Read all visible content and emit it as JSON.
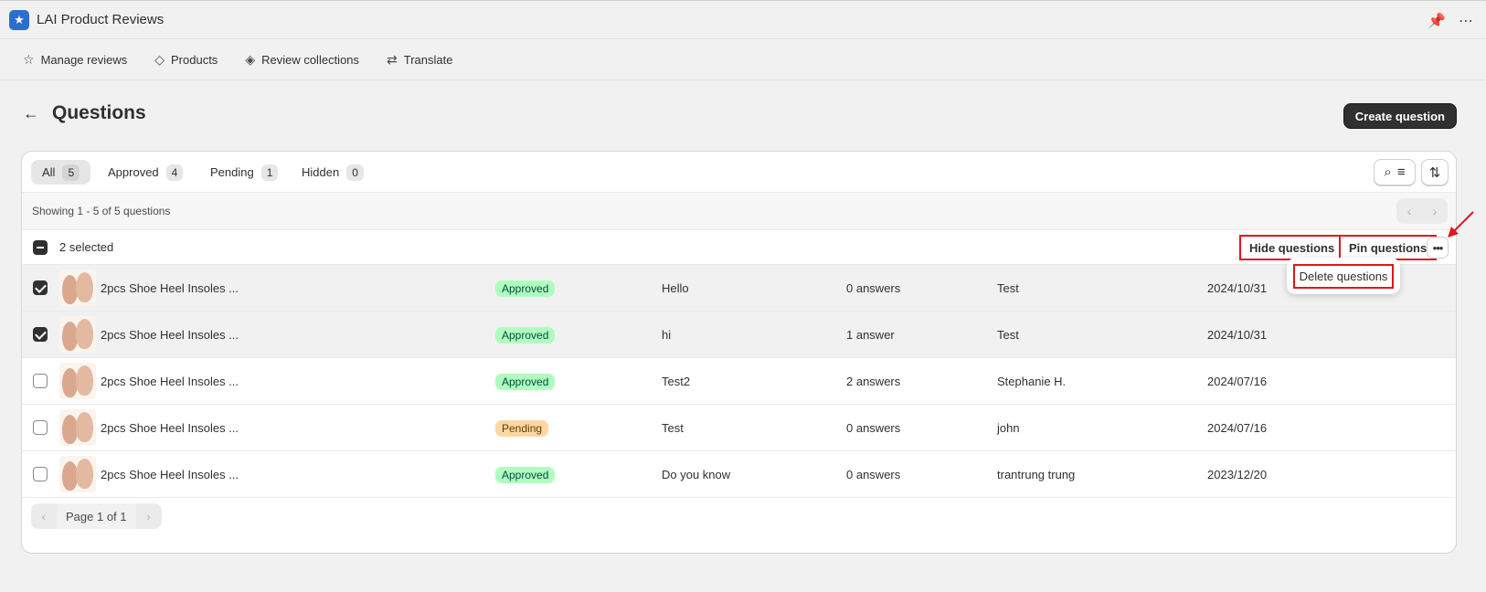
{
  "app": {
    "title": "LAI Product Reviews",
    "logo_icon": "star-app-icon"
  },
  "topbar": {
    "pin_icon": "pin-icon",
    "more_icon": "more-horizontal-icon"
  },
  "nav": [
    {
      "label": "Manage reviews",
      "icon": "☆"
    },
    {
      "label": "Products",
      "icon": "◇"
    },
    {
      "label": "Review collections",
      "icon": "◈"
    },
    {
      "label": "Translate",
      "icon": "⇄"
    }
  ],
  "page": {
    "title": "Questions",
    "create_button": "Create question"
  },
  "tabs": [
    {
      "label": "All",
      "count": "5"
    },
    {
      "label": "Approved",
      "count": "4"
    },
    {
      "label": "Pending",
      "count": "1"
    },
    {
      "label": "Hidden",
      "count": "0"
    }
  ],
  "showing": "Showing 1 - 5 of 5 questions",
  "bulk": {
    "selected": "2 selected",
    "hide": "Hide questions",
    "pin": "Pin questions",
    "more": "•••",
    "delete": "Delete questions"
  },
  "rows": [
    {
      "checked": true,
      "product": "2pcs Shoe Heel Insoles ...",
      "status": "Approved",
      "question": "Hello",
      "answers": "0 answers",
      "author": "Test",
      "date": "2024/10/31"
    },
    {
      "checked": true,
      "product": "2pcs Shoe Heel Insoles ...",
      "status": "Approved",
      "question": "hi",
      "answers": "1 answer",
      "author": "Test",
      "date": "2024/10/31"
    },
    {
      "checked": false,
      "product": "2pcs Shoe Heel Insoles ...",
      "status": "Approved",
      "question": "Test2",
      "answers": "2 answers",
      "author": "Stephanie H.",
      "date": "2024/07/16"
    },
    {
      "checked": false,
      "product": "2pcs Shoe Heel Insoles ...",
      "status": "Pending",
      "question": "Test",
      "answers": "0 answers",
      "author": "john",
      "date": "2024/07/16"
    },
    {
      "checked": false,
      "product": "2pcs Shoe Heel Insoles ...",
      "status": "Approved",
      "question": "Do you know",
      "answers": "0 answers",
      "author": "trantrung trung",
      "date": "2023/12/20"
    }
  ],
  "pagination": {
    "label": "Page 1 of 1"
  },
  "colors": {
    "accent_dark": "#303030",
    "highlight_red": "#e0161f",
    "approved_bg": "#affebf",
    "pending_bg": "#ffd6a4"
  }
}
